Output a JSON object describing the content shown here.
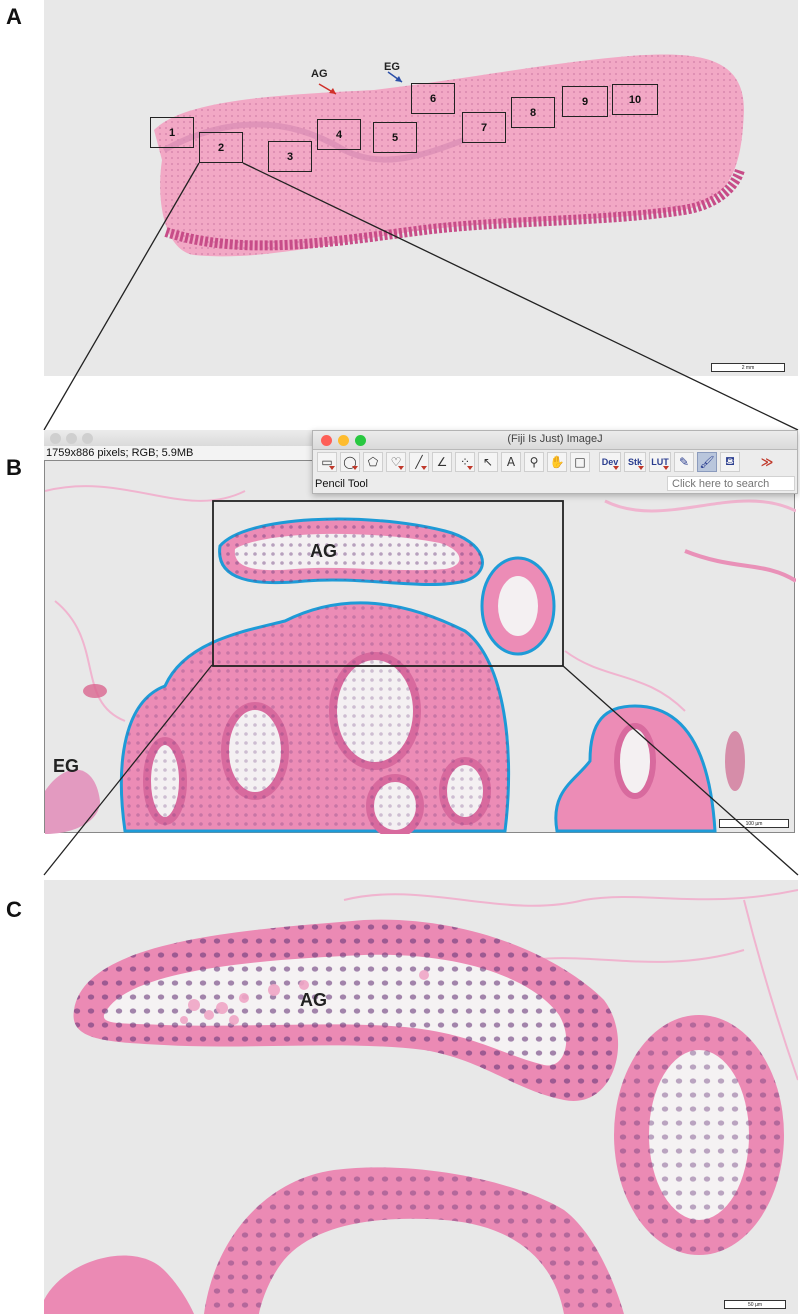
{
  "panel_a": {
    "letter": "A",
    "scalebar": "2 mm",
    "labels": {
      "ag": "AG",
      "eg": "EG"
    },
    "regions": [
      "1",
      "2",
      "3",
      "4",
      "5",
      "6",
      "7",
      "8",
      "9",
      "10"
    ],
    "colors": {
      "ag_arrow": "#d0302a",
      "eg_arrow": "#2b4fa8"
    }
  },
  "panel_b": {
    "letter": "B",
    "image_window": {
      "info": "1759x886 pixels; RGB; 5.9MB"
    },
    "imagej": {
      "title": "(Fiji Is Just) ImageJ",
      "status": "Pencil Tool",
      "search_placeholder": "Click here to search",
      "tools": [
        {
          "name": "rectangle-tool-icon",
          "glyph": "▭"
        },
        {
          "name": "oval-tool-icon",
          "glyph": "◯"
        },
        {
          "name": "polygon-tool-icon",
          "glyph": "⬠"
        },
        {
          "name": "freehand-tool-icon",
          "glyph": "♡"
        },
        {
          "name": "line-tool-icon",
          "glyph": "╱"
        },
        {
          "name": "angle-tool-icon",
          "glyph": "∠"
        },
        {
          "name": "multipoint-tool-icon",
          "glyph": "⁘"
        },
        {
          "name": "wand-tool-icon",
          "glyph": "↖"
        },
        {
          "name": "text-tool-icon",
          "glyph": "A"
        },
        {
          "name": "magnifier-tool-icon",
          "glyph": "🔍"
        },
        {
          "name": "hand-tool-icon",
          "glyph": "✋"
        },
        {
          "name": "color-picker-icon",
          "glyph": "□"
        }
      ],
      "menu_tools": [
        "Dev",
        "Stk",
        "LUT"
      ],
      "colors": {
        "close": "#fe5f57",
        "minimize": "#febc2e",
        "maximize": "#28c840",
        "overflow": "#c0392b"
      }
    },
    "labels": {
      "ag": "AG",
      "eg": "EG"
    },
    "scalebar": "100 µm",
    "colors": {
      "outline": "#1e9bd7"
    }
  },
  "panel_c": {
    "letter": "C",
    "labels": {
      "ag": "AG"
    },
    "scalebar": "50 µm"
  },
  "colors": {
    "stain_pink": "#e27aa6",
    "nuclei": "#6a3a7a",
    "background": "#e8e8e8"
  }
}
